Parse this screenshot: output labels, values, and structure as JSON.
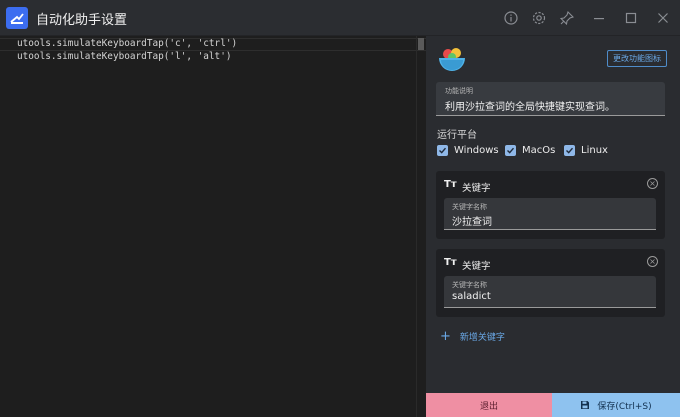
{
  "window": {
    "title": "自动化助手设置",
    "icons": [
      "info-icon",
      "settings-icon",
      "pin-icon",
      "minimize-icon",
      "maximize-icon",
      "close-icon"
    ]
  },
  "editor": {
    "lines": [
      "utools.simulateKeyboardTap('c', 'ctrl')",
      "utools.simulateKeyboardTap('l', 'alt')"
    ]
  },
  "panel": {
    "change_icon_label": "更改功能图标",
    "description": {
      "label": "功能说明",
      "value": "利用沙拉查词的全局快捷键实现查词。"
    },
    "platform_label": "运行平台",
    "platforms": [
      {
        "name": "Windows",
        "checked": true
      },
      {
        "name": "MacOs",
        "checked": true
      },
      {
        "name": "Linux",
        "checked": true
      }
    ],
    "keywords": [
      {
        "header": "关键字",
        "field_label": "关键字名称",
        "value": "沙拉查词"
      },
      {
        "header": "关键字",
        "field_label": "关键字名称",
        "value": "saladict"
      }
    ],
    "add_keyword_label": "新增关键字"
  },
  "footer": {
    "exit_label": "退出",
    "save_label": "保存(Ctrl+S)"
  },
  "colors": {
    "accent": "#3c6df0",
    "exit": "#ef8fa3",
    "save": "#8ec2ef",
    "checkbox": "#8fb8e8",
    "link": "#6aa8e6"
  }
}
